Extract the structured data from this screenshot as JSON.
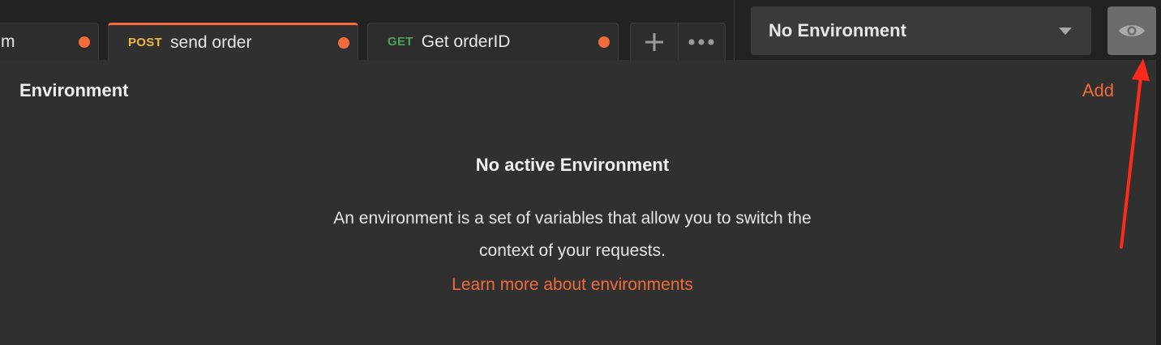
{
  "tabs": [
    {
      "method": "",
      "label": "m",
      "unsaved": true
    },
    {
      "method": "POST",
      "label": "send order",
      "unsaved": true,
      "active": true
    },
    {
      "method": "GET",
      "label": "Get orderID",
      "unsaved": true
    }
  ],
  "tab_tools": {
    "add_icon": "plus-icon",
    "more_icon": "ellipsis-icon"
  },
  "environment_selector": {
    "value": "No Environment",
    "caret_icon": "caret-down-icon"
  },
  "eye_button": {
    "icon": "eye-icon"
  },
  "panel": {
    "title": "Environment",
    "add_label": "Add",
    "empty_title": "No active Environment",
    "empty_description_line1": "An environment is a set of variables that allow you to switch the",
    "empty_description_line2": "context of your requests.",
    "learn_more_link": "Learn more about environments"
  },
  "colors": {
    "accent": "#f26b3a",
    "post_method": "#f4b73b",
    "get_method": "#4fa35b",
    "annotation_arrow": "#ff2a1a"
  }
}
